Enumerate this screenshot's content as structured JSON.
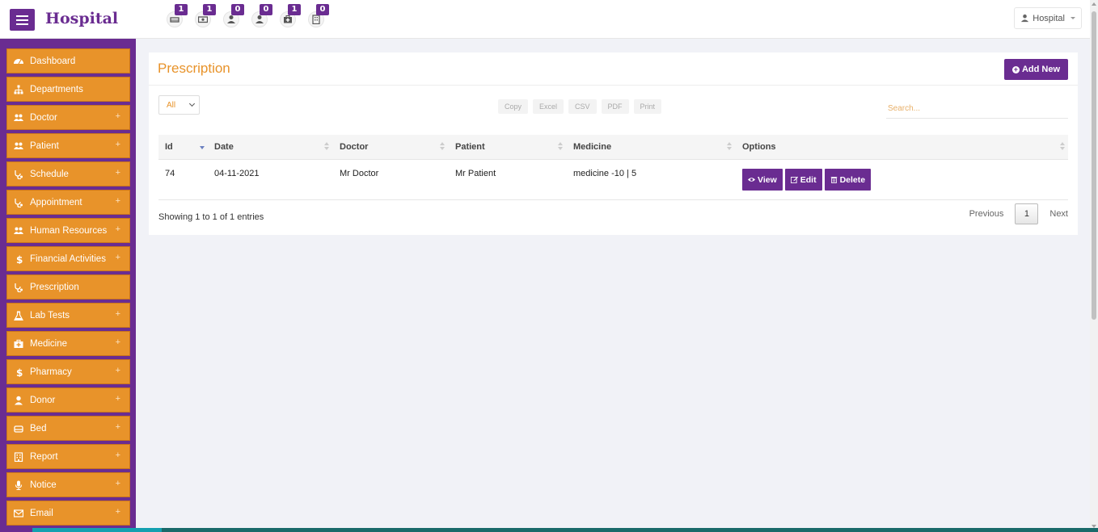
{
  "header": {
    "brand": "Hospital",
    "user_label": "Hospital",
    "notifications": [
      {
        "icon": "bed-icon",
        "count": "1"
      },
      {
        "icon": "money-icon",
        "count": "1"
      },
      {
        "icon": "user-icon",
        "count": "0"
      },
      {
        "icon": "user-icon",
        "count": "0"
      },
      {
        "icon": "medkit-icon",
        "count": "1"
      },
      {
        "icon": "hospital-icon",
        "count": "0"
      }
    ]
  },
  "sidebar": {
    "items": [
      {
        "label": "Dashboard",
        "icon": "dashboard-icon",
        "expandable": false
      },
      {
        "label": "Departments",
        "icon": "sitemap-icon",
        "expandable": false
      },
      {
        "label": "Doctor",
        "icon": "users-icon",
        "expandable": true
      },
      {
        "label": "Patient",
        "icon": "users-icon",
        "expandable": true
      },
      {
        "label": "Schedule",
        "icon": "stethoscope-icon",
        "expandable": true
      },
      {
        "label": "Appointment",
        "icon": "stethoscope-icon",
        "expandable": true
      },
      {
        "label": "Human Resources",
        "icon": "users-icon",
        "expandable": true
      },
      {
        "label": "Financial Activities",
        "icon": "dollar-icon",
        "expandable": true
      },
      {
        "label": "Prescription",
        "icon": "stethoscope-icon",
        "expandable": false
      },
      {
        "label": "Lab Tests",
        "icon": "flask-icon",
        "expandable": true
      },
      {
        "label": "Medicine",
        "icon": "medkit-icon",
        "expandable": true
      },
      {
        "label": "Pharmacy",
        "icon": "dollar-icon",
        "expandable": true
      },
      {
        "label": "Donor",
        "icon": "user-icon",
        "expandable": true
      },
      {
        "label": "Bed",
        "icon": "bed-icon",
        "expandable": true
      },
      {
        "label": "Report",
        "icon": "hospital-icon",
        "expandable": true
      },
      {
        "label": "Notice",
        "icon": "microphone-icon",
        "expandable": true
      },
      {
        "label": "Email",
        "icon": "envelope-icon",
        "expandable": true
      }
    ],
    "plus_symbol": "+"
  },
  "main": {
    "title": "Prescription",
    "add_new_label": "Add New",
    "length_select_value": "All",
    "export_buttons": [
      "Copy",
      "Excel",
      "CSV",
      "PDF",
      "Print"
    ],
    "search_placeholder": "Search...",
    "columns": [
      "Id",
      "Date",
      "Doctor",
      "Patient",
      "Medicine",
      "Options"
    ],
    "rows": [
      {
        "id": "74",
        "date": "04-11-2021",
        "doctor": "Mr Doctor",
        "patient": "Mr Patient",
        "medicine": "medicine -10 | 5"
      }
    ],
    "row_actions": {
      "view": "View",
      "edit": "Edit",
      "delete": "Delete"
    },
    "info_text": "Showing 1 to 1 of 1 entries",
    "pagination": {
      "previous": "Previous",
      "current": "1",
      "next": "Next"
    }
  },
  "colors": {
    "accent": "#6a2c91",
    "sidebar_item": "#e8932a",
    "title": "#e8932a"
  }
}
